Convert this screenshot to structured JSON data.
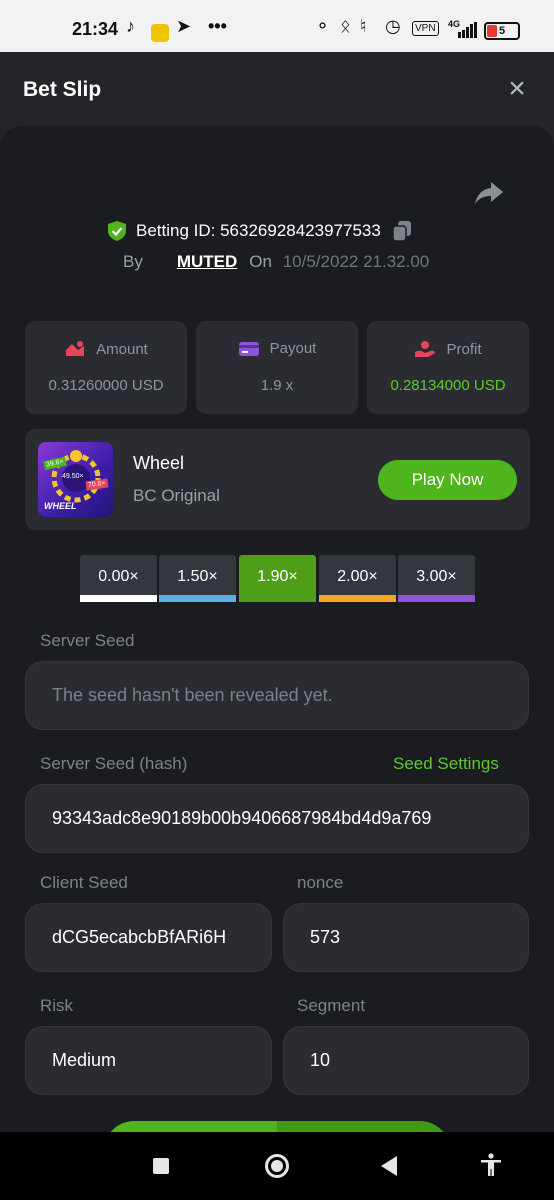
{
  "status_bar": {
    "time": "21:34",
    "battery": "5",
    "icons": [
      "tiktok-icon",
      "app-icon",
      "telegram-icon",
      "more-icon",
      "headphones-icon",
      "bluetooth-icon",
      "mute-icon",
      "alarm-icon",
      "vpn-icon",
      "signal-icon",
      "battery-icon"
    ],
    "vpn_label": "VPN",
    "network_label": "4G"
  },
  "header": {
    "title": "Bet Slip"
  },
  "bet": {
    "id_label": "Betting ID: 56326928423977533",
    "by_label": "By",
    "user": "MUTED",
    "on_label": "On",
    "date": "10/5/2022 21.32.00"
  },
  "stats": [
    {
      "label": "Amount",
      "value": "0.31260000 USD",
      "icon": "amount-icon"
    },
    {
      "label": "Payout",
      "value": "1.9 x",
      "icon": "card-icon"
    },
    {
      "label": "Profit",
      "value": "0.28134000 USD",
      "icon": "profit-icon"
    }
  ],
  "game": {
    "name": "Wheel",
    "subtitle": "BC Original",
    "thumb_text": "WHEEL",
    "thumb_badges": [
      "39.6×",
      "49.50×",
      "70.6×"
    ],
    "play_label": "Play Now"
  },
  "multipliers": [
    {
      "label": "0.00×",
      "color": "#ffffff",
      "active": false
    },
    {
      "label": "1.50×",
      "color": "#5aaee8",
      "active": false
    },
    {
      "label": "1.90×",
      "color": "#4f9e19",
      "active": true
    },
    {
      "label": "2.00×",
      "color": "#f5a524",
      "active": false
    },
    {
      "label": "3.00×",
      "color": "#8b55d6",
      "active": false
    }
  ],
  "fields": {
    "server_seed_label": "Server Seed",
    "server_seed_value": "The seed hasn't been revealed yet.",
    "server_hash_label": "Server Seed (hash)",
    "seed_settings_label": "Seed Settings",
    "server_hash_value": "93343adc8e90189b00b9406687984bd4d9a769",
    "client_seed_label": "Client Seed",
    "client_seed_value": "dCG5ecabcbBfARi6H",
    "nonce_label": "nonce",
    "nonce_value": "573",
    "risk_label": "Risk",
    "risk_value": "Medium",
    "segment_label": "Segment",
    "segment_value": "10"
  },
  "colors": {
    "accent_green": "#4fb51c",
    "profit_green": "#5ec92f",
    "panel_bg": "#1b1c20",
    "card_bg": "#2a2c31"
  }
}
